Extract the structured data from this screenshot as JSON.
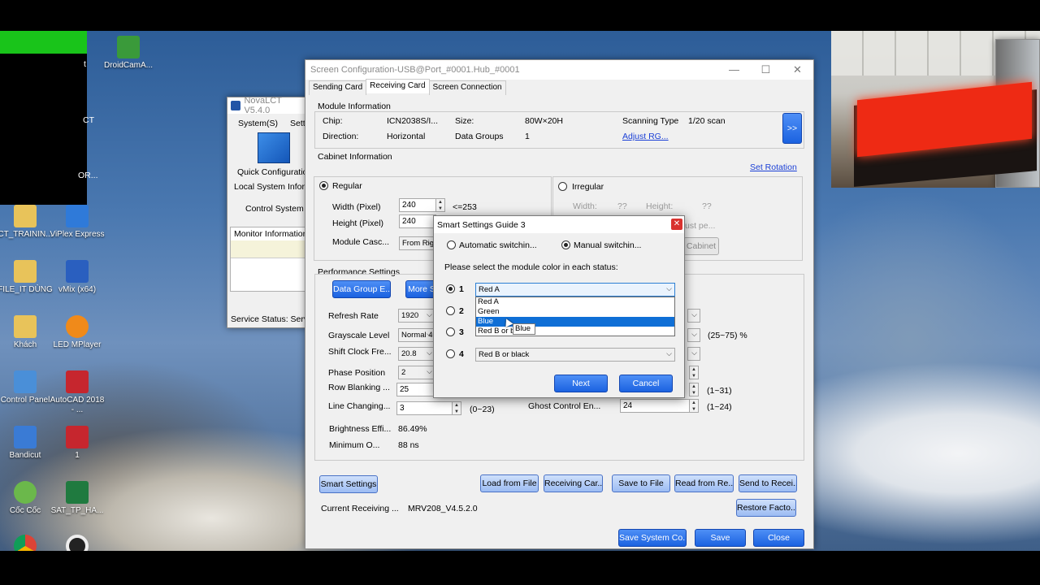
{
  "desktop": {
    "icons": [
      {
        "label": "DroidCamA...",
        "color": "#3a9a3a"
      },
      {
        "label": "ViPlex Express",
        "color": "#2f7ad9"
      },
      {
        "label": "CT_TRAININ...",
        "color": "#e8c35a"
      },
      {
        "label": "FILE_IT DÙNG",
        "color": "#e8c35a"
      },
      {
        "label": "vMix (x64)",
        "color": "#2a5fbf"
      },
      {
        "label": "Khách",
        "color": "#e8c35a"
      },
      {
        "label": "LED MPlayer",
        "color": "#f08a1a"
      },
      {
        "label": "Control Panel",
        "color": "#4a8fd8"
      },
      {
        "label": "AutoCAD 2018 - ...",
        "color": "#c6262e"
      },
      {
        "label": "Bandicut",
        "color": "#3a7bd5"
      },
      {
        "label": "1",
        "color": "#c6262e"
      },
      {
        "label": "Cốc Cốc",
        "color": "#6bb84b"
      },
      {
        "label": "SAT_TP_HA...",
        "color": "#1f7a3f"
      }
    ],
    "partial_labels": [
      "t",
      "CT",
      "OR..."
    ]
  },
  "nova": {
    "title": "NovaLCT V5.4.0",
    "menu": [
      "System(S)",
      "Setti"
    ],
    "quick_config": "Quick Configuratio",
    "local_info": "Local System Inform",
    "control_system": "Control System",
    "monitor_info": "Monitor Information",
    "service_status": "Service Status:  Serv"
  },
  "cfg": {
    "title": "Screen Configuration-USB@Port_#0001.Hub_#0001",
    "tabs": [
      "Sending Card",
      "Receiving Card",
      "Screen Connection"
    ],
    "module": {
      "heading": "Module Information",
      "chip_label": "Chip:",
      "chip": "ICN2038S/I...",
      "size_label": "Size:",
      "size": "80W×20H",
      "scan_label": "Scanning Type",
      "scan": "1/20 scan",
      "direction_label": "Direction:",
      "direction": "Horizontal",
      "groups_label": "Data Groups",
      "groups": "1",
      "adjust_link": "Adjust RG...",
      "expand": ">>"
    },
    "cabinet": {
      "heading": "Cabinet Information",
      "set_rotation": "Set Rotation",
      "regular": "Regular",
      "irregular": "Irregular",
      "width_label": "Width (Pixel)",
      "width": "240",
      "width_hint": "<=253",
      "height_label": "Height (Pixel)",
      "height": "240",
      "cascade_label": "Module Casc...",
      "cascade": "From Righ",
      "irr_width": "Width:",
      "irr_width_val": "??",
      "irr_height": "Height:",
      "irr_height_val": "??",
      "irr_adjust": "ust pe...",
      "irr_cabinet": "Cabinet"
    },
    "perf": {
      "heading": "Performance Settings",
      "data_group_btn": "Data Group E...",
      "more_btn": "More S",
      "refresh_label": "Refresh Rate",
      "refresh": "1920",
      "grayscale_label": "Grayscale Level",
      "grayscale": "Normal 409",
      "grayscale_hint": "(25~75) %",
      "shift_label": "Shift Clock Fre...",
      "shift": "20.8",
      "phase_label": "Phase Position",
      "phase": "2",
      "blanking_label": "Row Blanking ...",
      "blanking": "25",
      "blanking_hint": "(1~31)",
      "line_label": "Line Changing...",
      "line": "3",
      "line_hint": "(0~23)",
      "ghost_label": "Ghost Control En...",
      "ghost": "24",
      "ghost_hint": "(1~24)",
      "brightness_label": "Brightness Effi...",
      "brightness": "86.49%",
      "minimum_label": "Minimum O...",
      "minimum": "88 ns"
    },
    "buttons": {
      "smart": "Smart Settings",
      "load": "Load from File",
      "receiving": "Receiving Car...",
      "save_file": "Save to File",
      "read": "Read from Re...",
      "send": "Send to Recei...",
      "restore": "Restore Facto...",
      "save_system": "Save System Co...",
      "save": "Save",
      "close": "Close"
    },
    "current_label": "Current Receiving ...",
    "current_value": "MRV208_V4.5.2.0"
  },
  "dialog": {
    "title": "Smart Settings Guide 3",
    "auto": "Automatic switchin...",
    "manual": "Manual switchin...",
    "prompt": "Please select the module color in each status:",
    "status": [
      {
        "num": "1",
        "value": "Red A"
      },
      {
        "num": "2",
        "value": ""
      },
      {
        "num": "3",
        "value": ""
      },
      {
        "num": "4",
        "value": "Red B or black"
      }
    ],
    "options": [
      "Red A",
      "Green",
      "Blue",
      "Red B or b"
    ],
    "tooltip": "Blue",
    "next": "Next",
    "cancel": "Cancel"
  }
}
